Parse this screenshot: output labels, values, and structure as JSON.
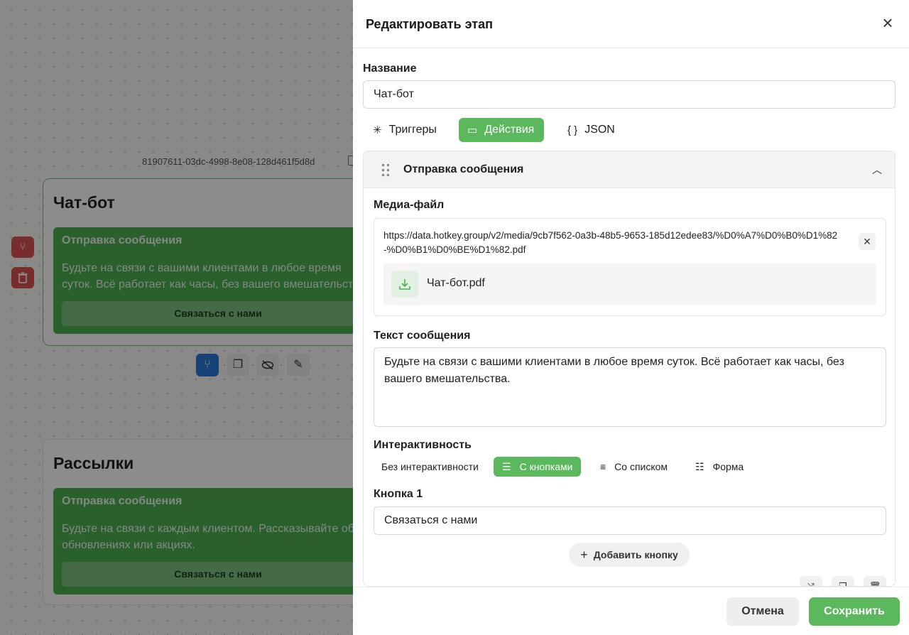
{
  "canvas": {
    "node_id": "81907611-03dc-4998-8e08-128d461f5d8d",
    "nodes": [
      {
        "title": "Чат-бот",
        "message_title": "Отправка сообщения",
        "message_text": "Будьте на связи с вашими клиентами в любое время суток. Всё работает как часы, без вашего вмешательства.",
        "button_label": "Связаться с нами"
      },
      {
        "title": "Рассылки",
        "message_title": "Отправка сообщения",
        "message_text": "Будьте на связи с каждым клиентом. Рассказывайте об обновлениях или акциях.",
        "button_label": "Связаться с нами"
      }
    ]
  },
  "drawer": {
    "title": "Редактировать этап",
    "name_label": "Название",
    "name_value": "Чат-бот",
    "tabs": [
      {
        "label": "Триггеры",
        "icon": "sparkle-icon",
        "active": false
      },
      {
        "label": "Действия",
        "icon": "message-icon",
        "active": true
      },
      {
        "label": "JSON",
        "icon": "braces-icon",
        "active": false
      }
    ],
    "section": {
      "title": "Отправка сообщения",
      "media_label": "Медиа-файл",
      "media_url": "https://data.hotkey.group/v2/media/9cb7f562-0a3b-48b5-9653-185d12edee83/%D0%A7%D0%B0%D1%82-%D0%B1%D0%BE%D1%82.pdf",
      "file_name": "Чат-бот.pdf",
      "text_label": "Текст сообщения",
      "text_value": "Будьте на связи с вашими клиентами в любое время суток. Всё работает как часы, без вашего вмешательства.",
      "interactivity_label": "Интерактивность",
      "interactivity_tabs": [
        {
          "label": "Без интерактивности",
          "icon": "",
          "active": false
        },
        {
          "label": "С кнопками",
          "icon": "buttons-icon",
          "active": true
        },
        {
          "label": "Со списком",
          "icon": "list-icon",
          "active": false
        },
        {
          "label": "Форма",
          "icon": "form-icon",
          "active": false
        }
      ],
      "button1_label": "Кнопка 1",
      "button1_value": "Связаться с нами",
      "add_button_label": "Добавить кнопку"
    },
    "footer": {
      "cancel_label": "Отмена",
      "save_label": "Сохранить"
    }
  },
  "colors": {
    "accent_green": "#5cb85c",
    "danger_red": "#d9534f",
    "primary_blue": "#2b79d6"
  }
}
